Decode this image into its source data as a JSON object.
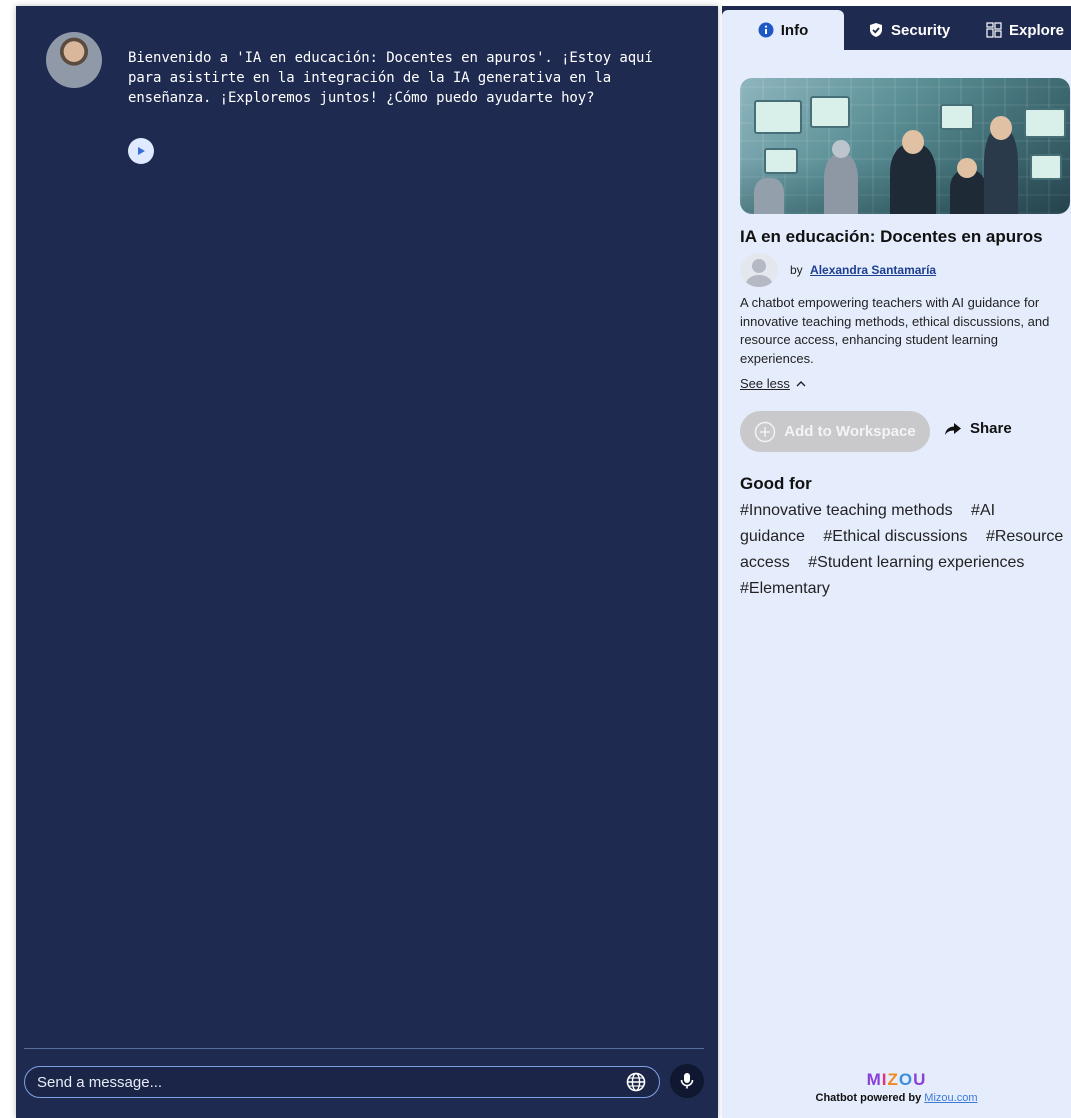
{
  "chat": {
    "welcome_message": "Bienvenido a 'IA en educación: Docentes en apuros'. ¡Estoy aquí para asistirte en la integración de la IA generativa en la enseñanza. ¡Exploremos juntos! ¿Cómo puedo ayudarte hoy?",
    "input_placeholder": "Send a message..."
  },
  "tabs": [
    {
      "label": "Info",
      "icon": "info-circle-icon",
      "active": true
    },
    {
      "label": "Security",
      "icon": "shield-check-icon",
      "active": false
    },
    {
      "label": "Explore",
      "icon": "grid-icon",
      "active": false
    }
  ],
  "bot": {
    "title": "IA en educación: Docentes en apuros",
    "by_prefix": "by",
    "author": "Alexandra Santamaría",
    "description": "A chatbot empowering teachers with AI guidance for innovative teaching methods, ethical discussions, and resource access, enhancing student learning experiences.",
    "see_less": "See less"
  },
  "actions": {
    "add_to_workspace": "Add to Workspace",
    "share": "Share"
  },
  "good_for": {
    "title": "Good for",
    "tags": [
      "#Innovative teaching methods",
      "#AI guidance",
      "#Ethical discussions",
      "#Resource access",
      "#Student learning experiences",
      "#Elementary"
    ]
  },
  "footer": {
    "brand": [
      "M",
      "I",
      "Z",
      "O",
      "U"
    ],
    "powered_prefix": "Chatbot powered by",
    "powered_link": "Mizou.com"
  },
  "colors": {
    "chat_background": "#1e2a4f",
    "panel_background": "#e5edfd",
    "link": "#1d3f8f"
  }
}
